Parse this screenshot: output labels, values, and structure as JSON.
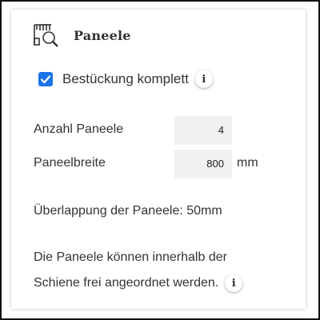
{
  "header": {
    "icon": "panel-search-icon",
    "title": "Paneele"
  },
  "complete": {
    "checked": true,
    "label": "Bestückung komplett",
    "info_icon": "info-icon",
    "info_glyph": "i"
  },
  "fields": {
    "count_label": "Anzahl Paneele",
    "count_value": "4",
    "width_label": "Paneelbreite",
    "width_value": "800",
    "width_unit": "mm"
  },
  "overlap_text": "Überlappung der Paneele: 50mm",
  "note": {
    "line1": "Die Paneele können innerhalb der",
    "line2": "Schiene frei angeordnet werden.",
    "info_glyph": "i"
  },
  "colors": {
    "checkbox": "#1a73e8",
    "input_bg": "#f1f1f1",
    "text": "#333333"
  }
}
